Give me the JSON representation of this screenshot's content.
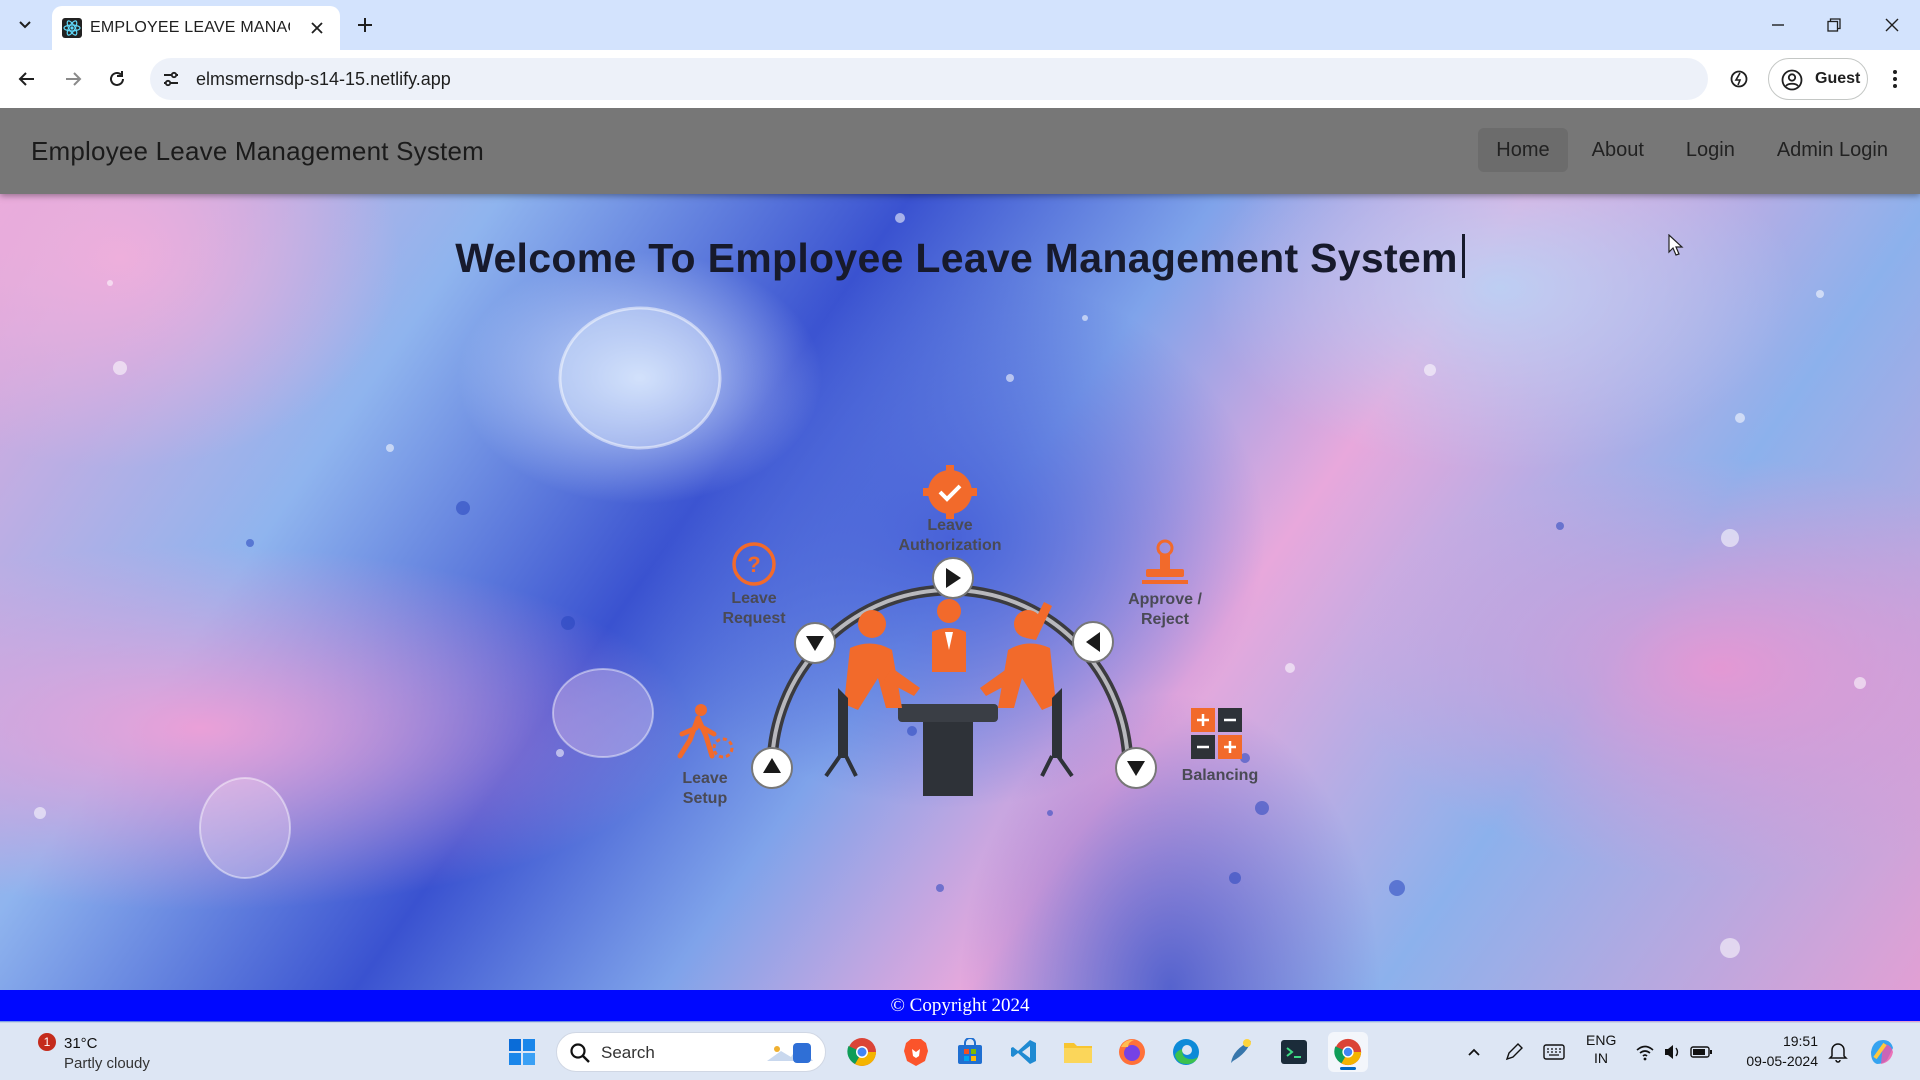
{
  "browser": {
    "tab_title": "EMPLOYEE LEAVE MANAGEMEN",
    "url": "elmsmernsdp-s14-15.netlify.app",
    "profile_label": "Guest"
  },
  "site": {
    "brand": "Employee Leave Management System",
    "nav": [
      {
        "label": "Home",
        "active": true
      },
      {
        "label": "About",
        "active": false
      },
      {
        "label": "Login",
        "active": false
      },
      {
        "label": "Admin Login",
        "active": false
      }
    ],
    "welcome": "Welcome To Employee Leave Management System",
    "diagram": {
      "leave_authorization": [
        "Leave",
        "Authorization"
      ],
      "leave_request": [
        "Leave",
        "Request"
      ],
      "approve_reject": [
        "Approve /",
        "Reject"
      ],
      "leave_setup": [
        "Leave",
        "Setup"
      ],
      "balancing": "Balancing"
    },
    "footer": "© Copyright 2024"
  },
  "taskbar": {
    "weather_alert": "1",
    "temperature": "31°C",
    "condition": "Partly cloudy",
    "search_placeholder": "Search",
    "lang_line1": "ENG",
    "lang_line2": "IN",
    "time": "19:51",
    "date": "09-05-2024"
  },
  "colors": {
    "accent_orange": "#f26a2b",
    "footer_blue": "#0008ff",
    "navbar_gray": "#777777"
  }
}
